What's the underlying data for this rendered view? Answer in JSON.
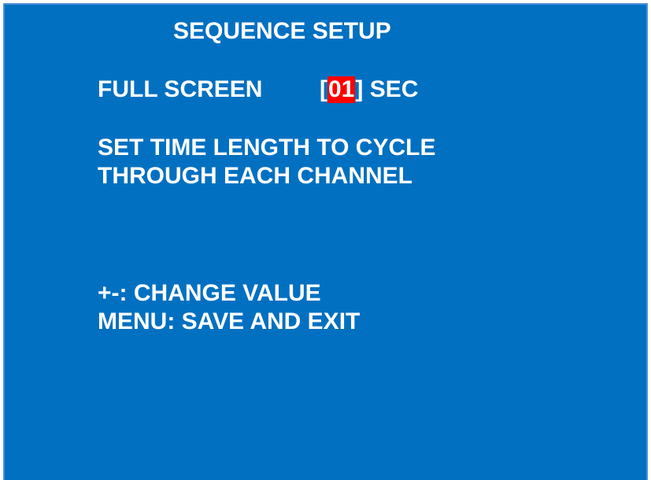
{
  "title": "SEQUENCE SETUP",
  "full_screen": {
    "label": "FULL SCREEN",
    "bracket_open": "[",
    "value": "01",
    "bracket_close": "]",
    "unit": "SEC"
  },
  "description": {
    "line1": "SET TIME LENGTH TO CYCLE",
    "line2": "THROUGH EACH CHANNEL"
  },
  "help": {
    "line1": "+-: CHANGE VALUE",
    "line2": "MENU: SAVE AND EXIT"
  },
  "colors": {
    "background": "#0270c1",
    "highlight": "#ff0000",
    "text": "#ffffff"
  }
}
